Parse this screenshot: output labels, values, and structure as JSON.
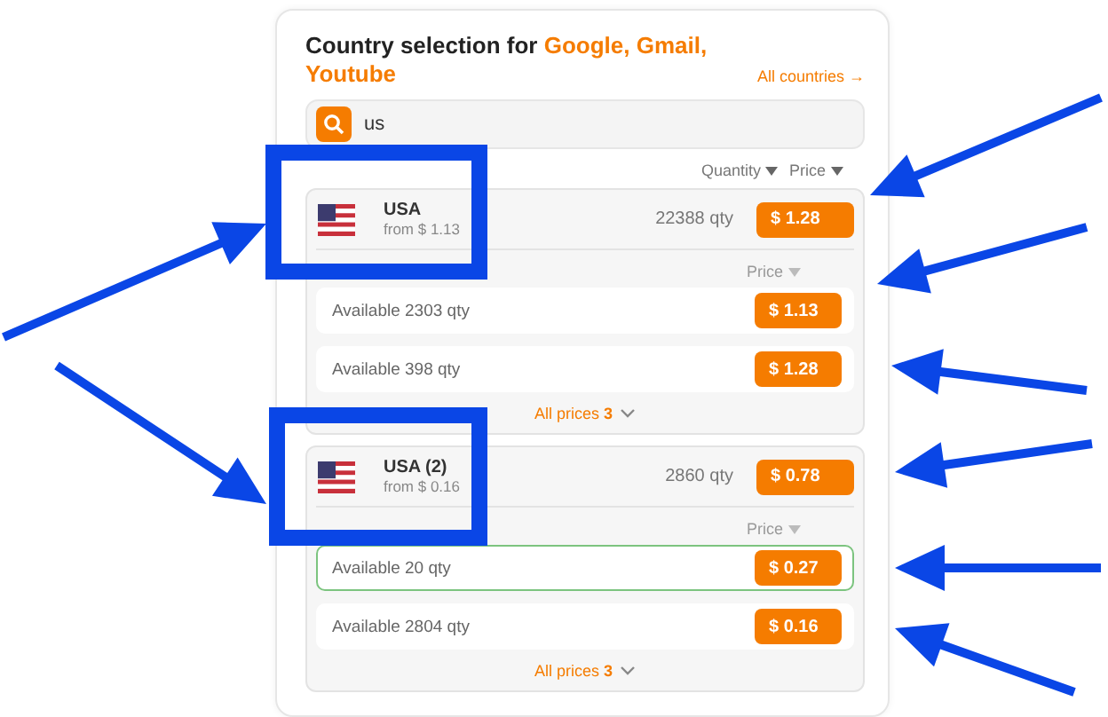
{
  "title": {
    "prefix": "Country selection for ",
    "services": "Google, Gmail, Youtube"
  },
  "all_countries": "All countries →",
  "search": {
    "value": "us"
  },
  "sort_headers": [
    "Quantity",
    "Price"
  ],
  "groups": [
    {
      "country": "USA",
      "from": "from $ 1.13",
      "quantity": "22388 qty",
      "price": "$ 1.28",
      "price_header": "Price",
      "offers": [
        {
          "text": "Available 2303 qty",
          "price": "$ 1.13",
          "selected": false
        },
        {
          "text": "Available 398 qty",
          "price": "$ 1.28",
          "selected": false
        }
      ],
      "all_prices": "All prices",
      "count": "3"
    },
    {
      "country": "USA (2)",
      "from": "from $ 0.16",
      "quantity": "2860 qty",
      "price": "$ 0.78",
      "price_header": "Price",
      "offers": [
        {
          "text": "Available 20 qty",
          "price": "$ 0.27",
          "selected": true
        },
        {
          "text": "Available 2804 qty",
          "price": "$ 0.16",
          "selected": false
        }
      ],
      "all_prices": "All prices",
      "count": "3"
    }
  ]
}
